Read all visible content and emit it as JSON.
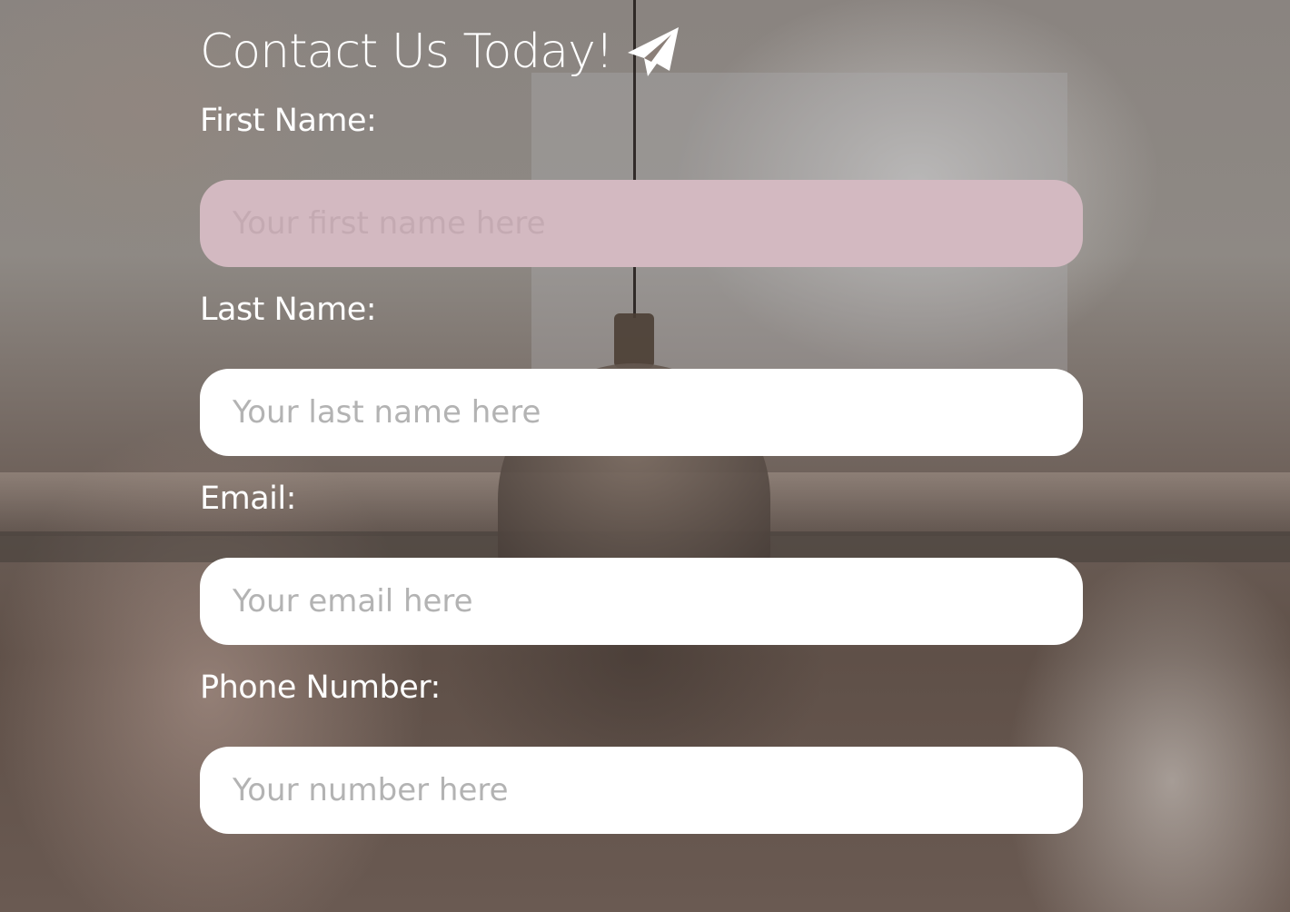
{
  "form": {
    "title": "Contact Us Today!",
    "title_icon": "paper-plane-icon",
    "fields": [
      {
        "label": "First Name:",
        "placeholder": "Your first name here",
        "value": "",
        "focused": true
      },
      {
        "label": "Last Name:",
        "placeholder": "Your last name here",
        "value": "",
        "focused": false
      },
      {
        "label": "Email:",
        "placeholder": "Your email here",
        "value": "",
        "focused": false
      },
      {
        "label": "Phone Number:",
        "placeholder": "Your number here",
        "value": "",
        "focused": false
      }
    ]
  },
  "colors": {
    "text": "#ffffff",
    "input_background": "#ffffff",
    "input_focused_background": "#d3b9c1",
    "placeholder": "#b3b3b3"
  }
}
